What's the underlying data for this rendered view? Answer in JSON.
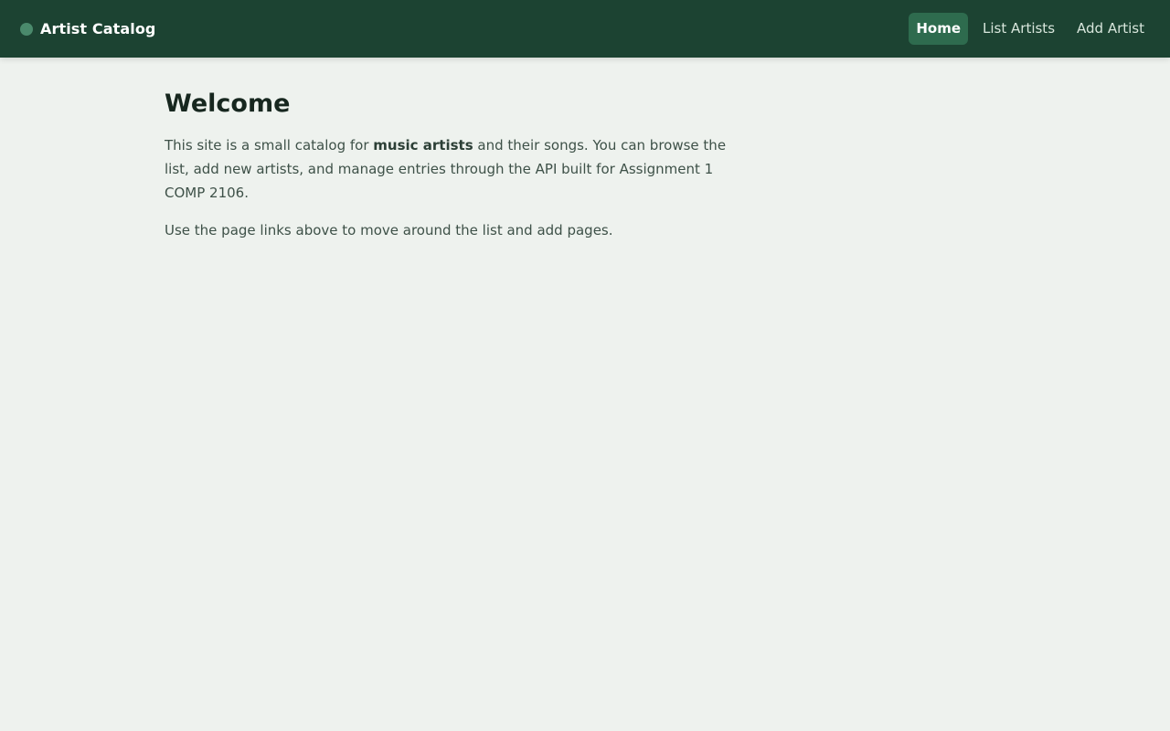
{
  "header": {
    "brand": "Artist Catalog",
    "nav": [
      {
        "label": "Home",
        "active": true
      },
      {
        "label": "List Artists",
        "active": false
      },
      {
        "label": "Add Artist",
        "active": false
      }
    ]
  },
  "main": {
    "title": "Welcome",
    "intro_part1": "This site is a small catalog for ",
    "intro_bold": "music artists",
    "intro_part2": " and their songs. You can browse the list, add new artists, and manage entries through the API built for Assignment 1 COMP 2106.",
    "hint": "Use the page links above to move around the list and add pages."
  },
  "colors": {
    "header_bg": "#1c4332",
    "active_nav_bg": "#2e6b4e",
    "page_bg": "#eef2ee",
    "brand_dot": "#4a8a6c"
  },
  "icons": {
    "brand": "circle-dot-icon"
  }
}
